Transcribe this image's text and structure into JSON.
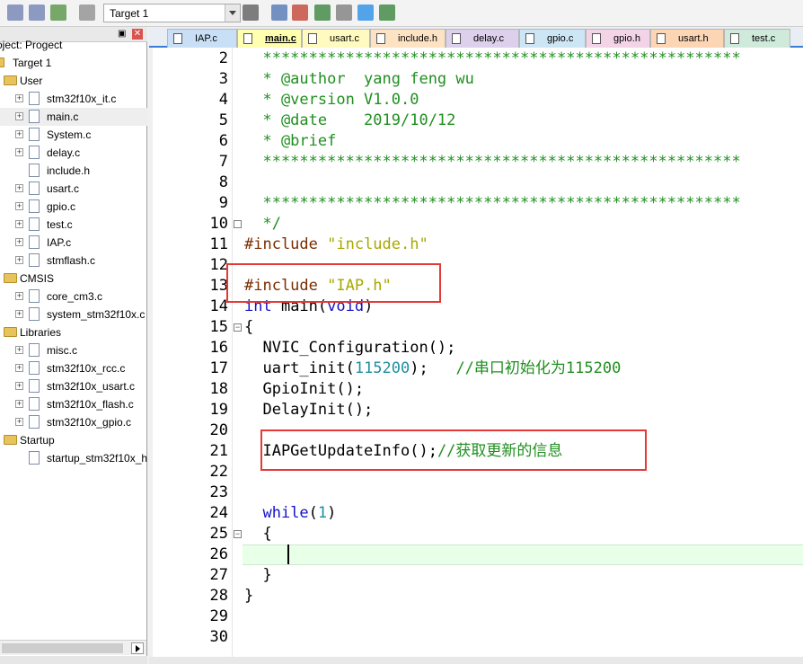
{
  "toolbar": {
    "target": "Target 1",
    "icons": [
      "save-all-icon",
      "options-icon",
      "stack-icon",
      "batch-icon",
      "load-icon",
      "magic-wand-icon",
      "translate-icon",
      "build-icon",
      "rebuild-icon",
      "download-icon",
      "debug-icon"
    ]
  },
  "project": {
    "tree": [
      {
        "label": "roject: Progect",
        "level": 0,
        "type": "root"
      },
      {
        "label": "Target 1",
        "level": 1,
        "type": "target"
      },
      {
        "label": "User",
        "level": 2,
        "type": "folder"
      },
      {
        "label": "stm32f10x_it.c",
        "level": 3,
        "type": "file",
        "expander": true
      },
      {
        "label": "main.c",
        "level": 3,
        "type": "file",
        "expander": true,
        "selected": true
      },
      {
        "label": "System.c",
        "level": 3,
        "type": "file",
        "expander": true
      },
      {
        "label": "delay.c",
        "level": 3,
        "type": "file",
        "expander": true
      },
      {
        "label": "include.h",
        "level": 3,
        "type": "file",
        "expander": false
      },
      {
        "label": "usart.c",
        "level": 3,
        "type": "file",
        "expander": true
      },
      {
        "label": "gpio.c",
        "level": 3,
        "type": "file",
        "expander": true
      },
      {
        "label": "test.c",
        "level": 3,
        "type": "file",
        "expander": true
      },
      {
        "label": "IAP.c",
        "level": 3,
        "type": "file",
        "expander": true
      },
      {
        "label": "stmflash.c",
        "level": 3,
        "type": "file",
        "expander": true
      },
      {
        "label": "CMSIS",
        "level": 2,
        "type": "folder"
      },
      {
        "label": "core_cm3.c",
        "level": 3,
        "type": "file",
        "expander": true
      },
      {
        "label": "system_stm32f10x.c",
        "level": 3,
        "type": "file",
        "expander": true
      },
      {
        "label": "Libraries",
        "level": 2,
        "type": "folder"
      },
      {
        "label": "misc.c",
        "level": 3,
        "type": "file",
        "expander": true
      },
      {
        "label": "stm32f10x_rcc.c",
        "level": 3,
        "type": "file",
        "expander": true
      },
      {
        "label": "stm32f10x_usart.c",
        "level": 3,
        "type": "file",
        "expander": true
      },
      {
        "label": "stm32f10x_flash.c",
        "level": 3,
        "type": "file",
        "expander": true
      },
      {
        "label": "stm32f10x_gpio.c",
        "level": 3,
        "type": "file",
        "expander": true
      },
      {
        "label": "Startup",
        "level": 2,
        "type": "folder"
      },
      {
        "label": "startup_stm32f10x_h",
        "level": 3,
        "type": "file",
        "expander": false
      }
    ]
  },
  "tabs": [
    {
      "label": "IAP.c",
      "color": "#c9dff5",
      "active": false
    },
    {
      "label": "main.c",
      "color": "#ffffb0",
      "active": true
    },
    {
      "label": "usart.c",
      "color": "#fffbc0",
      "active": false
    },
    {
      "label": "include.h",
      "color": "#fde3c3",
      "active": false
    },
    {
      "label": "delay.c",
      "color": "#dcd0ec",
      "active": false
    },
    {
      "label": "gpio.c",
      "color": "#cde6f5",
      "active": false
    },
    {
      "label": "gpio.h",
      "color": "#f3d3e6",
      "active": false
    },
    {
      "label": "usart.h",
      "color": "#fcd5b4",
      "active": false
    },
    {
      "label": "test.c",
      "color": "#cfeadb",
      "active": false
    }
  ],
  "editor": {
    "current_line": 26,
    "lines": [
      {
        "n": 2,
        "tokens": [
          [
            "c-comment",
            "  ****************************************************"
          ]
        ]
      },
      {
        "n": 3,
        "tokens": [
          [
            "c-comment",
            "  * @author  yang feng wu"
          ]
        ]
      },
      {
        "n": 4,
        "tokens": [
          [
            "c-comment",
            "  * @version V1.0.0"
          ]
        ]
      },
      {
        "n": 5,
        "tokens": [
          [
            "c-comment",
            "  * @date    2019/10/12"
          ]
        ]
      },
      {
        "n": 6,
        "tokens": [
          [
            "c-comment",
            "  * @brief"
          ]
        ]
      },
      {
        "n": 7,
        "tokens": [
          [
            "c-comment",
            "  ****************************************************"
          ]
        ]
      },
      {
        "n": 8,
        "tokens": []
      },
      {
        "n": 9,
        "tokens": [
          [
            "c-comment",
            "  ****************************************************"
          ]
        ]
      },
      {
        "n": 10,
        "tokens": [
          [
            "c-comment",
            "  */"
          ]
        ]
      },
      {
        "n": 11,
        "tokens": [
          [
            "c-pre",
            "#include "
          ],
          [
            "c-str",
            "\"include.h\""
          ]
        ]
      },
      {
        "n": 12,
        "tokens": []
      },
      {
        "n": 13,
        "tokens": [
          [
            "c-pre",
            "#include "
          ],
          [
            "c-str",
            "\"IAP.h\""
          ]
        ]
      },
      {
        "n": 14,
        "tokens": [
          [
            "c-kw",
            "int"
          ],
          [
            "",
            " main("
          ],
          [
            "c-kw",
            "void"
          ],
          [
            "",
            ")"
          ]
        ]
      },
      {
        "n": 15,
        "tokens": [
          [
            "",
            "{"
          ]
        ]
      },
      {
        "n": 16,
        "tokens": [
          [
            "",
            "  NVIC_Configuration();"
          ]
        ]
      },
      {
        "n": 17,
        "tokens": [
          [
            "",
            "  uart_init("
          ],
          [
            "c-num",
            "115200"
          ],
          [
            "",
            ");   "
          ],
          [
            "c-comment",
            "//串口初始化为115200"
          ]
        ]
      },
      {
        "n": 18,
        "tokens": [
          [
            "",
            "  GpioInit();"
          ]
        ]
      },
      {
        "n": 19,
        "tokens": [
          [
            "",
            "  DelayInit();"
          ]
        ]
      },
      {
        "n": 20,
        "tokens": []
      },
      {
        "n": 21,
        "tokens": [
          [
            "",
            "  IAPGetUpdateInfo();"
          ],
          [
            "c-comment",
            "//获取更新的信息"
          ]
        ]
      },
      {
        "n": 22,
        "tokens": []
      },
      {
        "n": 23,
        "tokens": []
      },
      {
        "n": 24,
        "tokens": [
          [
            "",
            "  "
          ],
          [
            "c-kw",
            "while"
          ],
          [
            "",
            "("
          ],
          [
            "c-num",
            "1"
          ],
          [
            "",
            ")"
          ]
        ]
      },
      {
        "n": 25,
        "tokens": [
          [
            "",
            "  {"
          ]
        ]
      },
      {
        "n": 26,
        "tokens": [
          [
            "",
            "    "
          ]
        ]
      },
      {
        "n": 27,
        "tokens": [
          [
            "",
            "  }"
          ]
        ]
      },
      {
        "n": 28,
        "tokens": [
          [
            "",
            "}"
          ]
        ]
      },
      {
        "n": 29,
        "tokens": []
      },
      {
        "n": 30,
        "tokens": []
      }
    ]
  }
}
